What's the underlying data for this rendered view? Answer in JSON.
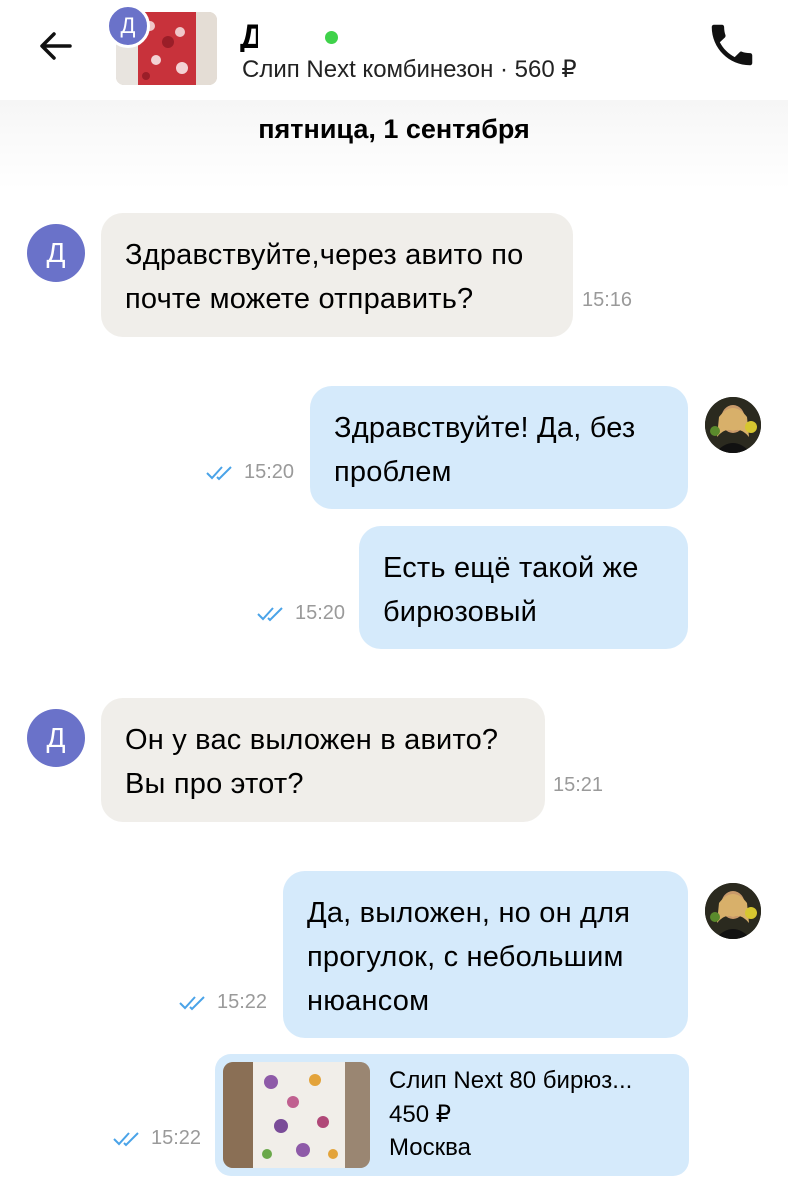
{
  "header": {
    "seller_initial": "Д",
    "seller_name": "Д",
    "listing": "Слип Next комбинезон · 560 ₽"
  },
  "date_separator": "пятница, 1 сентября",
  "messages": [
    {
      "direction": "in",
      "avatar": "Д",
      "lines": [
        "Здравствуйте,через авито по",
        "почте можете отправить?"
      ],
      "time": "15:16"
    },
    {
      "direction": "out",
      "lines": [
        "Здравствуйте! Да, без",
        "проблем"
      ],
      "time": "15:20",
      "status": "read"
    },
    {
      "direction": "out",
      "lines": [
        "Есть ещё такой же",
        "бирюзовый"
      ],
      "time": "15:20",
      "status": "read"
    },
    {
      "direction": "in",
      "avatar": "Д",
      "lines": [
        "Он у вас выложен в авито?",
        "Вы про этот?"
      ],
      "time": "15:21"
    },
    {
      "direction": "out",
      "lines": [
        "Да, выложен, но он для",
        "прогулок, с небольшим",
        "нюансом"
      ],
      "time": "15:22",
      "status": "read"
    }
  ],
  "product_card": {
    "title": "Слип Next 80 бирюз...",
    "price": "450 ₽",
    "city": "Москва",
    "time": "15:22",
    "status": "read"
  },
  "colors": {
    "incoming_bubble": "#f0eeea",
    "outgoing_bubble": "#d5eafb",
    "avatar": "#6a72c9",
    "read_ticks": "#4aa3e8",
    "online": "#3fd24a"
  }
}
